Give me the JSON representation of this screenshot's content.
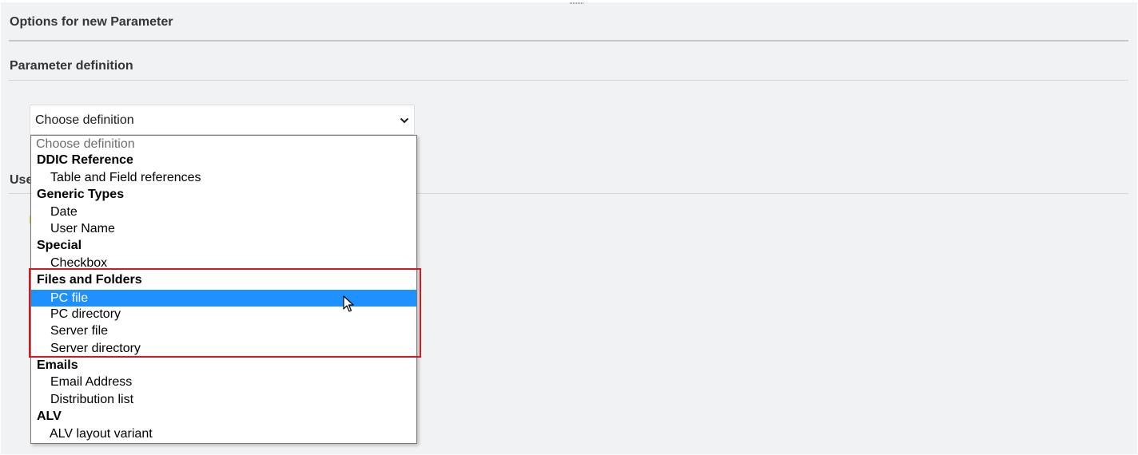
{
  "page": {
    "title": "Options for new Parameter",
    "section_title": "Parameter definition",
    "section2_title_partial": "Use"
  },
  "select": {
    "value": "Choose definition",
    "icon": "chevron-down-icon"
  },
  "dropdown": {
    "placeholder": "Choose definition",
    "groups": [
      {
        "label": "DDIC Reference",
        "items": [
          "Table and Field references"
        ]
      },
      {
        "label": "Generic Types",
        "items": [
          "Date",
          "User Name"
        ]
      },
      {
        "label": "Special",
        "items": [
          "Checkbox"
        ]
      },
      {
        "label": "Files and Folders",
        "items": [
          "PC file",
          "PC directory",
          "Server file",
          "Server directory"
        ]
      },
      {
        "label": "Emails",
        "items": [
          "Email Address",
          "Distribution list"
        ]
      },
      {
        "label": "ALV",
        "items": [
          "ALV layout variant"
        ]
      }
    ],
    "hovered_item": "PC file"
  },
  "colors": {
    "background": "#f1f2f4",
    "selection": "#1e90ff",
    "highlight_frame": "#d3191c"
  },
  "annotation": {
    "highlighted_group": "Files and Folders"
  },
  "cursor": {
    "icon": "mouse-pointer-icon"
  }
}
